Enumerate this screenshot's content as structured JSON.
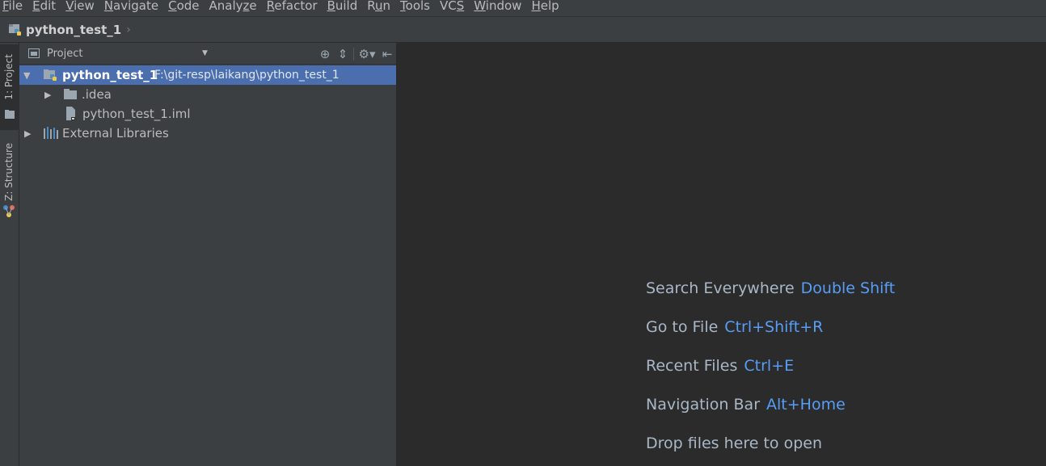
{
  "menu": {
    "items": [
      {
        "pre": "",
        "u": "F",
        "post": "ile"
      },
      {
        "pre": "",
        "u": "E",
        "post": "dit"
      },
      {
        "pre": "",
        "u": "V",
        "post": "iew"
      },
      {
        "pre": "",
        "u": "N",
        "post": "avigate"
      },
      {
        "pre": "",
        "u": "C",
        "post": "ode"
      },
      {
        "pre": "Analy",
        "u": "z",
        "post": "e"
      },
      {
        "pre": "",
        "u": "R",
        "post": "efactor"
      },
      {
        "pre": "",
        "u": "B",
        "post": "uild"
      },
      {
        "pre": "R",
        "u": "u",
        "post": "n"
      },
      {
        "pre": "",
        "u": "T",
        "post": "ools"
      },
      {
        "pre": "VC",
        "u": "S",
        "post": ""
      },
      {
        "pre": "",
        "u": "W",
        "post": "indow"
      },
      {
        "pre": "",
        "u": "H",
        "post": "elp"
      }
    ]
  },
  "navbar": {
    "project_name": "python_test_1",
    "chevron": "›"
  },
  "toolstrip": {
    "project_tab": "1: Project",
    "structure_tab": "Z: Structure"
  },
  "panel": {
    "title": "Project",
    "dropdown": "▼",
    "tools": {
      "locate_icon": "⊕",
      "collapse_icon": "⇕",
      "settings_icon": "⚙▾",
      "hide_icon": "⇤"
    }
  },
  "tree": {
    "root_arrow": "▼",
    "root_name": "python_test_1",
    "root_path": "F:\\git-resp\\laikang\\python_test_1",
    "idea_arrow": "▶",
    "idea_name": ".idea",
    "iml_name": "python_test_1.iml",
    "ext_arrow": "▶",
    "ext_name": "External Libraries"
  },
  "editor": {
    "hints": [
      {
        "label": "Search Everywhere",
        "key": "Double Shift"
      },
      {
        "label": "Go to File",
        "key": "Ctrl+Shift+R"
      },
      {
        "label": "Recent Files",
        "key": "Ctrl+E"
      },
      {
        "label": "Navigation Bar",
        "key": "Alt+Home"
      },
      {
        "label": "Drop files here to open",
        "key": ""
      }
    ]
  },
  "colors": {
    "background": "#2b2b2b",
    "panel": "#3c3f41",
    "selection": "#4b6eaf",
    "shortcut": "#589df6",
    "hint_text": "#a9b7c6"
  }
}
